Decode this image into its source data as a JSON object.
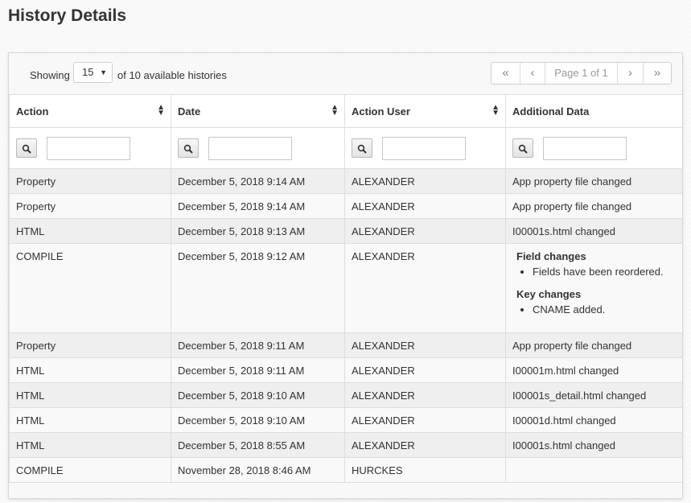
{
  "page": {
    "title": "History Details"
  },
  "toolbar": {
    "showing_label": "Showing",
    "page_size": "15",
    "available_label": "of 10 available histories"
  },
  "pager": {
    "first": "«",
    "prev": "‹",
    "info": "Page 1 of 1",
    "next": "›",
    "last": "»"
  },
  "columns": [
    "Action",
    "Date",
    "Action User",
    "Additional Data"
  ],
  "rows": [
    {
      "action": "Property",
      "date": "December 5, 2018 9:14 AM",
      "user": "ALEXANDER",
      "data": "App property file changed"
    },
    {
      "action": "Property",
      "date": "December 5, 2018 9:14 AM",
      "user": "ALEXANDER",
      "data": "App property file changed"
    },
    {
      "action": "HTML",
      "date": "December 5, 2018 9:13 AM",
      "user": "ALEXANDER",
      "data": "I00001s.html changed"
    },
    {
      "action": "COMPILE",
      "date": "December 5, 2018 9:12 AM",
      "user": "ALEXANDER",
      "details": [
        {
          "title": "Field changes",
          "items": [
            "Fields have been reordered."
          ]
        },
        {
          "title": "Key changes",
          "items": [
            "CNAME added."
          ]
        }
      ]
    },
    {
      "action": "Property",
      "date": "December 5, 2018 9:11 AM",
      "user": "ALEXANDER",
      "data": "App property file changed"
    },
    {
      "action": "HTML",
      "date": "December 5, 2018 9:11 AM",
      "user": "ALEXANDER",
      "data": "I00001m.html changed"
    },
    {
      "action": "HTML",
      "date": "December 5, 2018 9:10 AM",
      "user": "ALEXANDER",
      "data": "I00001s_detail.html changed"
    },
    {
      "action": "HTML",
      "date": "December 5, 2018 9:10 AM",
      "user": "ALEXANDER",
      "data": "I00001d.html changed"
    },
    {
      "action": "HTML",
      "date": "December 5, 2018 8:55 AM",
      "user": "ALEXANDER",
      "data": "I00001s.html changed"
    },
    {
      "action": "COMPILE",
      "date": "November 28, 2018 8:46 AM",
      "user": "HURCKES",
      "data": ""
    }
  ],
  "icons": {
    "sort": "sort-icon",
    "filter": "search-icon",
    "dropdown": "caret-down-icon"
  }
}
